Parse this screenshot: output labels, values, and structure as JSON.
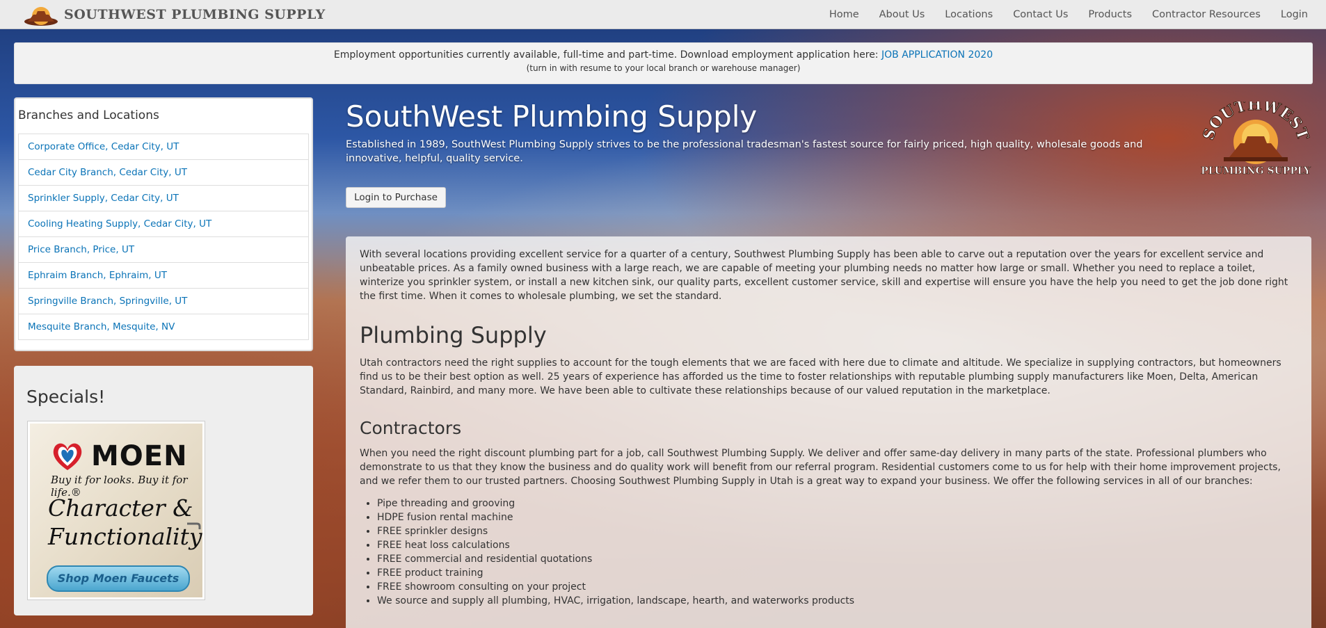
{
  "navbar": {
    "brand_name": "SOUTHWEST PLUMBING SUPPLY",
    "brand_logo_icon": "mesa-sunset-logo-icon",
    "items": [
      "Home",
      "About Us",
      "Locations",
      "Contact Us",
      "Products",
      "Contractor Resources",
      "Login"
    ]
  },
  "employment": {
    "text": "Employment opportunities currently available, full-time and part-time. Download employment application here: ",
    "link": "JOB APPLICATION 2020",
    "note": "(turn in with resume to your local branch or warehouse manager)"
  },
  "branches": {
    "title": "Branches and Locations",
    "items": [
      "Corporate Office, Cedar City, UT",
      "Cedar City Branch, Cedar City, UT",
      "Sprinkler Supply, Cedar City, UT",
      "Cooling Heating Supply, Cedar City, UT",
      "Price Branch, Price, UT",
      "Ephraim Branch, Ephraim, UT",
      "Springville Branch, Springville, UT",
      "Mesquite Branch, Mesquite, NV"
    ]
  },
  "specials": {
    "title": "Specials!",
    "ad": {
      "brand": "MOEN",
      "tagline": "Buy it for looks. Buy it for life.®",
      "line1": "Character &",
      "line2": "Functionality",
      "button": "Shop Moen Faucets"
    }
  },
  "hero": {
    "title": "SouthWest Plumbing Supply",
    "description": "Established in 1989, SouthWest Plumbing Supply strives to be the professional tradesman's fastest source for fairly priced, high quality, wholesale goods and innovative, helpful, quality service.",
    "login_button": "Login to Purchase",
    "badge": {
      "top": "SOUTHWEST",
      "bottom": "PLUMBING SUPPLY"
    }
  },
  "content": {
    "intro": "With several locations providing excellent service for a quarter of a century, Southwest Plumbing Supply has been able to carve out a reputation over the years for excellent service and unbeatable prices. As a family owned business with a large reach, we are capable of meeting your plumbing needs no matter how large or small. Whether you need to replace a toilet, winterize you sprinkler system, or install a new kitchen sink, our quality parts, excellent customer service, skill and expertise will ensure you have the help you need to get the job done right the first time. When it comes to wholesale plumbing, we set the standard.",
    "plumbing_heading": "Plumbing Supply",
    "plumbing_text": "Utah contractors need the right supplies to account for the tough elements that we are faced with here due to climate and altitude. We specialize in supplying contractors, but homeowners find us to be their best option as well. 25 years of experience has afforded us the time to foster relationships with reputable plumbing supply manufacturers like Moen, Delta, American Standard, Rainbird, and many more. We have been able to cultivate these relationships because of our valued reputation in the marketplace.",
    "contractors_heading": "Contractors",
    "contractors_text": "When you need the right discount plumbing part for a job, call Southwest Plumbing Supply. We deliver and offer same-day delivery in many parts of the state. Professional plumbers who demonstrate to us that they know the business and do quality work will benefit from our referral program. Residential customers come to us for help with their home improvement projects, and we refer them to our trusted partners. Choosing Southwest Plumbing Supply in Utah is a great way to expand your business. We offer the following services in all of our branches:",
    "services": [
      "Pipe threading and grooving",
      "HDPE fusion rental machine",
      "FREE sprinkler designs",
      "FREE heat loss calculations",
      "FREE commercial and residential quotations",
      "FREE product training",
      "FREE showroom consulting on your project",
      "We source and supply all plumbing, HVAC, irrigation, landscape, hearth, and waterworks products"
    ]
  }
}
